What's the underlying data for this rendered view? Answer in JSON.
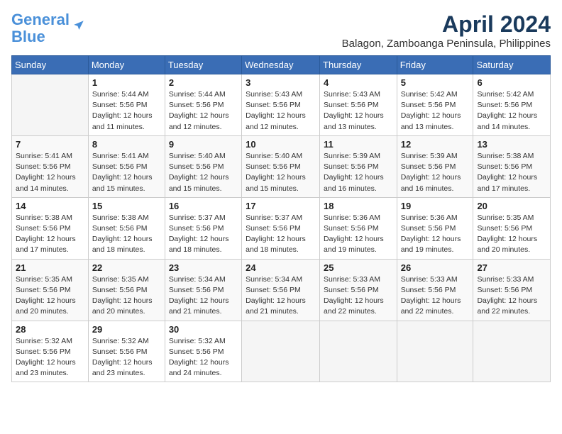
{
  "header": {
    "logo_line1": "General",
    "logo_line2": "Blue",
    "month": "April 2024",
    "location": "Balagon, Zamboanga Peninsula, Philippines"
  },
  "days_of_week": [
    "Sunday",
    "Monday",
    "Tuesday",
    "Wednesday",
    "Thursday",
    "Friday",
    "Saturday"
  ],
  "weeks": [
    [
      {
        "num": "",
        "info": ""
      },
      {
        "num": "1",
        "info": "Sunrise: 5:44 AM\nSunset: 5:56 PM\nDaylight: 12 hours\nand 11 minutes."
      },
      {
        "num": "2",
        "info": "Sunrise: 5:44 AM\nSunset: 5:56 PM\nDaylight: 12 hours\nand 12 minutes."
      },
      {
        "num": "3",
        "info": "Sunrise: 5:43 AM\nSunset: 5:56 PM\nDaylight: 12 hours\nand 12 minutes."
      },
      {
        "num": "4",
        "info": "Sunrise: 5:43 AM\nSunset: 5:56 PM\nDaylight: 12 hours\nand 13 minutes."
      },
      {
        "num": "5",
        "info": "Sunrise: 5:42 AM\nSunset: 5:56 PM\nDaylight: 12 hours\nand 13 minutes."
      },
      {
        "num": "6",
        "info": "Sunrise: 5:42 AM\nSunset: 5:56 PM\nDaylight: 12 hours\nand 14 minutes."
      }
    ],
    [
      {
        "num": "7",
        "info": "Sunrise: 5:41 AM\nSunset: 5:56 PM\nDaylight: 12 hours\nand 14 minutes."
      },
      {
        "num": "8",
        "info": "Sunrise: 5:41 AM\nSunset: 5:56 PM\nDaylight: 12 hours\nand 15 minutes."
      },
      {
        "num": "9",
        "info": "Sunrise: 5:40 AM\nSunset: 5:56 PM\nDaylight: 12 hours\nand 15 minutes."
      },
      {
        "num": "10",
        "info": "Sunrise: 5:40 AM\nSunset: 5:56 PM\nDaylight: 12 hours\nand 15 minutes."
      },
      {
        "num": "11",
        "info": "Sunrise: 5:39 AM\nSunset: 5:56 PM\nDaylight: 12 hours\nand 16 minutes."
      },
      {
        "num": "12",
        "info": "Sunrise: 5:39 AM\nSunset: 5:56 PM\nDaylight: 12 hours\nand 16 minutes."
      },
      {
        "num": "13",
        "info": "Sunrise: 5:38 AM\nSunset: 5:56 PM\nDaylight: 12 hours\nand 17 minutes."
      }
    ],
    [
      {
        "num": "14",
        "info": "Sunrise: 5:38 AM\nSunset: 5:56 PM\nDaylight: 12 hours\nand 17 minutes."
      },
      {
        "num": "15",
        "info": "Sunrise: 5:38 AM\nSunset: 5:56 PM\nDaylight: 12 hours\nand 18 minutes."
      },
      {
        "num": "16",
        "info": "Sunrise: 5:37 AM\nSunset: 5:56 PM\nDaylight: 12 hours\nand 18 minutes."
      },
      {
        "num": "17",
        "info": "Sunrise: 5:37 AM\nSunset: 5:56 PM\nDaylight: 12 hours\nand 18 minutes."
      },
      {
        "num": "18",
        "info": "Sunrise: 5:36 AM\nSunset: 5:56 PM\nDaylight: 12 hours\nand 19 minutes."
      },
      {
        "num": "19",
        "info": "Sunrise: 5:36 AM\nSunset: 5:56 PM\nDaylight: 12 hours\nand 19 minutes."
      },
      {
        "num": "20",
        "info": "Sunrise: 5:35 AM\nSunset: 5:56 PM\nDaylight: 12 hours\nand 20 minutes."
      }
    ],
    [
      {
        "num": "21",
        "info": "Sunrise: 5:35 AM\nSunset: 5:56 PM\nDaylight: 12 hours\nand 20 minutes."
      },
      {
        "num": "22",
        "info": "Sunrise: 5:35 AM\nSunset: 5:56 PM\nDaylight: 12 hours\nand 20 minutes."
      },
      {
        "num": "23",
        "info": "Sunrise: 5:34 AM\nSunset: 5:56 PM\nDaylight: 12 hours\nand 21 minutes."
      },
      {
        "num": "24",
        "info": "Sunrise: 5:34 AM\nSunset: 5:56 PM\nDaylight: 12 hours\nand 21 minutes."
      },
      {
        "num": "25",
        "info": "Sunrise: 5:33 AM\nSunset: 5:56 PM\nDaylight: 12 hours\nand 22 minutes."
      },
      {
        "num": "26",
        "info": "Sunrise: 5:33 AM\nSunset: 5:56 PM\nDaylight: 12 hours\nand 22 minutes."
      },
      {
        "num": "27",
        "info": "Sunrise: 5:33 AM\nSunset: 5:56 PM\nDaylight: 12 hours\nand 22 minutes."
      }
    ],
    [
      {
        "num": "28",
        "info": "Sunrise: 5:32 AM\nSunset: 5:56 PM\nDaylight: 12 hours\nand 23 minutes."
      },
      {
        "num": "29",
        "info": "Sunrise: 5:32 AM\nSunset: 5:56 PM\nDaylight: 12 hours\nand 23 minutes."
      },
      {
        "num": "30",
        "info": "Sunrise: 5:32 AM\nSunset: 5:56 PM\nDaylight: 12 hours\nand 24 minutes."
      },
      {
        "num": "",
        "info": ""
      },
      {
        "num": "",
        "info": ""
      },
      {
        "num": "",
        "info": ""
      },
      {
        "num": "",
        "info": ""
      }
    ]
  ]
}
